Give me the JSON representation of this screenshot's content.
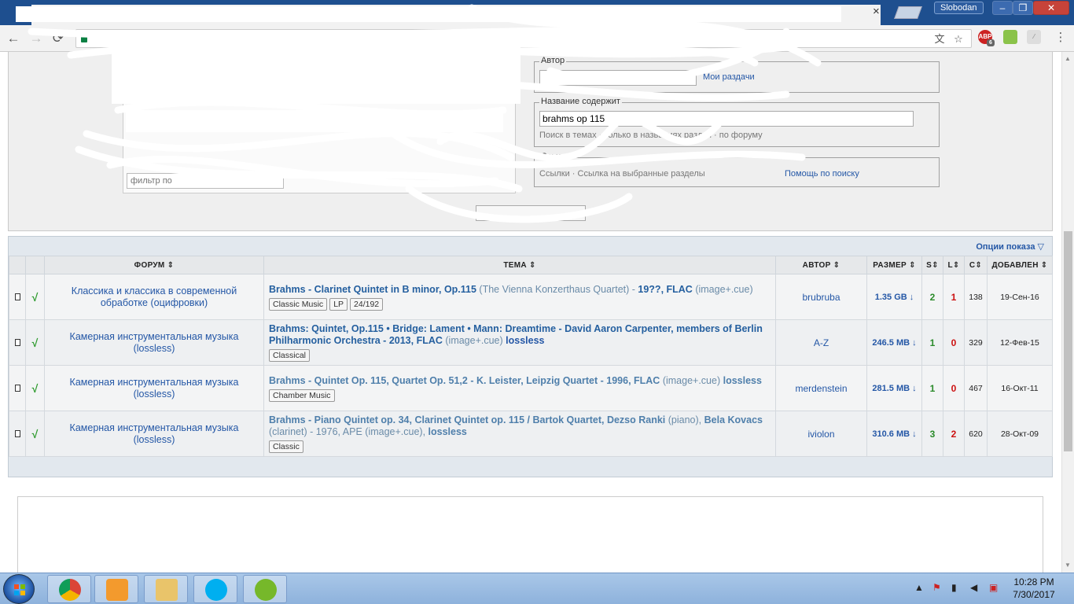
{
  "browser": {
    "user": "Slobodan",
    "secure_label": "Secure",
    "tab_close": "×",
    "win_min": "–",
    "win_max": "❐",
    "win_close": "✕",
    "back": "←",
    "forward": "→",
    "reload": "⟳",
    "ext_badge": "6",
    "icons": [
      "back-icon",
      "forward-icon",
      "reload-icon",
      "lock-icon",
      "translate-icon",
      "star-icon",
      "adblock-icon",
      "extension-icon",
      "acrobat-icon",
      "menu-icon"
    ]
  },
  "search": {
    "filter_placeholder": "фильтр по",
    "author_legend": "Автор",
    "my_releases": "Мои раздачи",
    "title_legend": "Название содержит",
    "title_value": "brahms op 115",
    "help_link": "Помощь по поиску",
    "fragments": {
      "title_options": "Поиск в темах · только в названиях раздач · по форуму",
      "other_legend": "Ссылки",
      "links_row": "Ссылки · Ссылка на выбранные разделы"
    }
  },
  "results": {
    "options_label": "Опции показа",
    "columns": {
      "forum": "ФОРУМ",
      "topic": "ТЕМА",
      "author": "АВТОР",
      "size": "РАЗМЕР",
      "seeds": "S",
      "leech": "L",
      "completed": "C",
      "added": "ДОБАВЛЕН"
    },
    "rows": [
      {
        "forum": "Классика и классика в современной обработке (оцифровки)",
        "title_main": "Brahms - Clarinet Quintet in B minor, Op.115",
        "title_sub": " (The Vienna Konzerthaus Quartet) - ",
        "title_main2": "19??, FLAC",
        "title_sub2": " (image+.cue)",
        "title_extra": "",
        "tags": [
          "Classic Music",
          "LP",
          "24/192"
        ],
        "author": "brubruba",
        "size": "1.35 GB ↓",
        "seeds": "2",
        "leech": "1",
        "completed": "138",
        "added": "19-Сен-16"
      },
      {
        "forum": "Камерная инструментальная музыка (lossless)",
        "title_main": "Brahms: Quintet, Op.115 • Bridge: Lament • Mann: Dreamtime - David Aaron Carpenter, members of Berlin Philharmonic Orchestra - 2013, FLAC",
        "title_sub": " (image+.cue) ",
        "title_main2": "",
        "title_sub2": "",
        "title_extra": "lossless",
        "tags": [
          "Classical"
        ],
        "author": "A-Z",
        "size": "246.5 MB ↓",
        "seeds": "1",
        "leech": "0",
        "completed": "329",
        "added": "12-Фев-15"
      },
      {
        "forum": "Камерная инструментальная музыка (lossless)",
        "title_main": "Brahms - Quintet Op. 115, Quartet Op. 51,2 - K. Leister, Leipzig Quartet - 1996, FLAC",
        "title_sub": " (image+.cue) ",
        "title_main2": "",
        "title_sub2": "",
        "title_extra": "lossless",
        "tags": [
          "Chamber Music"
        ],
        "author": "merdenstein",
        "size": "281.5 MB ↓",
        "seeds": "1",
        "leech": "0",
        "completed": "467",
        "added": "16-Окт-11"
      },
      {
        "forum": "Камерная инструментальная музыка (lossless)",
        "title_main": "Brahms - Piano Quintet op. 34, Clarinet Quintet op. 115 / Bartok Quartet, Dezso Ranki",
        "title_sub": " (piano), ",
        "title_main2": "Bela Kovacs",
        "title_sub2": " (clarinet) - 1976, APE (image+.cue), ",
        "title_extra": "lossless",
        "tags": [
          "Classic"
        ],
        "author": "iviolon",
        "size": "310.6 MB ↓",
        "seeds": "3",
        "leech": "2",
        "completed": "620",
        "added": "28-Окт-09"
      }
    ]
  },
  "taskbar": {
    "time": "10:28 PM",
    "date": "7/30/2017",
    "apps": [
      "chrome-icon",
      "media-player-icon",
      "explorer-icon",
      "skype-icon",
      "utorrent-icon"
    ]
  },
  "colors": {
    "titlebar": "#1e4f8f",
    "link": "#2457a6",
    "seeds": "#2a8a2a",
    "leech": "#cc1111",
    "taskbar": "#9dbde3"
  }
}
